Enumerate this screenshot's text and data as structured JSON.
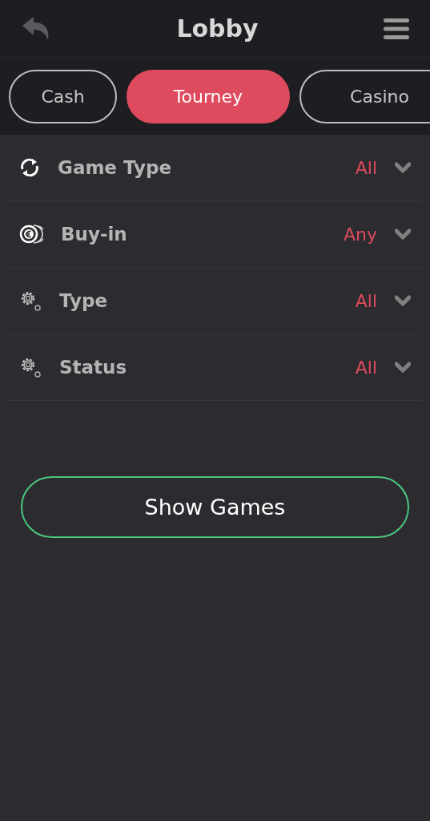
{
  "header": {
    "title": "Lobby"
  },
  "tabs": [
    {
      "label": "Cash",
      "selected": false
    },
    {
      "label": "Tourney",
      "selected": true
    },
    {
      "label": "Casino",
      "selected": false
    }
  ],
  "filters": [
    {
      "kind": "refresh",
      "label": "Game Type",
      "value": "All"
    },
    {
      "kind": "coins",
      "label": "Buy-in",
      "value": "Any"
    },
    {
      "kind": "gears",
      "label": "Type",
      "value": "All"
    },
    {
      "kind": "gears",
      "label": "Status",
      "value": "All"
    }
  ],
  "action": {
    "label": "Show Games"
  }
}
